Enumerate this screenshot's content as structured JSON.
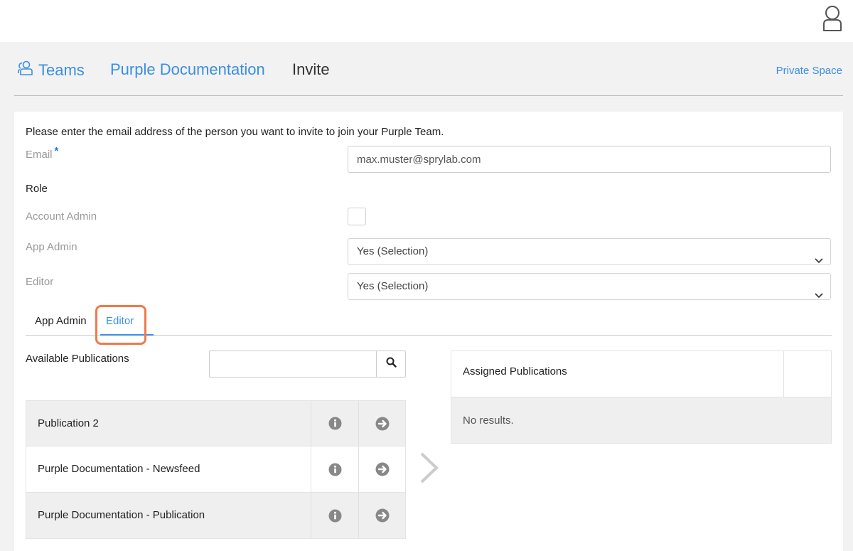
{
  "header": {
    "user_icon": "user-icon"
  },
  "breadcrumb": {
    "teams_icon": "team-icon",
    "teams": "Teams",
    "documentation": "Purple Documentation",
    "current": "Invite",
    "private_space": "Private Space"
  },
  "form": {
    "intro": "Please enter the email address of the person you want to invite to join your Purple Team.",
    "email_label": "Email",
    "required_mark": "*",
    "email_value": "max.muster@sprylab.com",
    "role_heading": "Role",
    "account_admin_label": "Account Admin",
    "account_admin_checked": false,
    "app_admin_label": "App Admin",
    "app_admin_value": "Yes (Selection)",
    "editor_label": "Editor",
    "editor_value": "Yes (Selection)"
  },
  "tabs": [
    {
      "label": "App Admin",
      "active": false
    },
    {
      "label": "Editor",
      "active": true
    }
  ],
  "available": {
    "heading": "Available Publications",
    "search_value": "",
    "search_icon": "search-icon",
    "items": [
      {
        "name": "Publication 2"
      },
      {
        "name": "Purple Documentation - Newsfeed"
      },
      {
        "name": "Purple Documentation - Publication"
      }
    ],
    "info_icon": "info-icon",
    "add_icon": "arrow-right-circle-icon"
  },
  "assigned": {
    "heading": "Assigned Publications",
    "empty": "No results."
  },
  "colors": {
    "accent": "#3a8ee6",
    "highlight": "#f07a4a"
  }
}
